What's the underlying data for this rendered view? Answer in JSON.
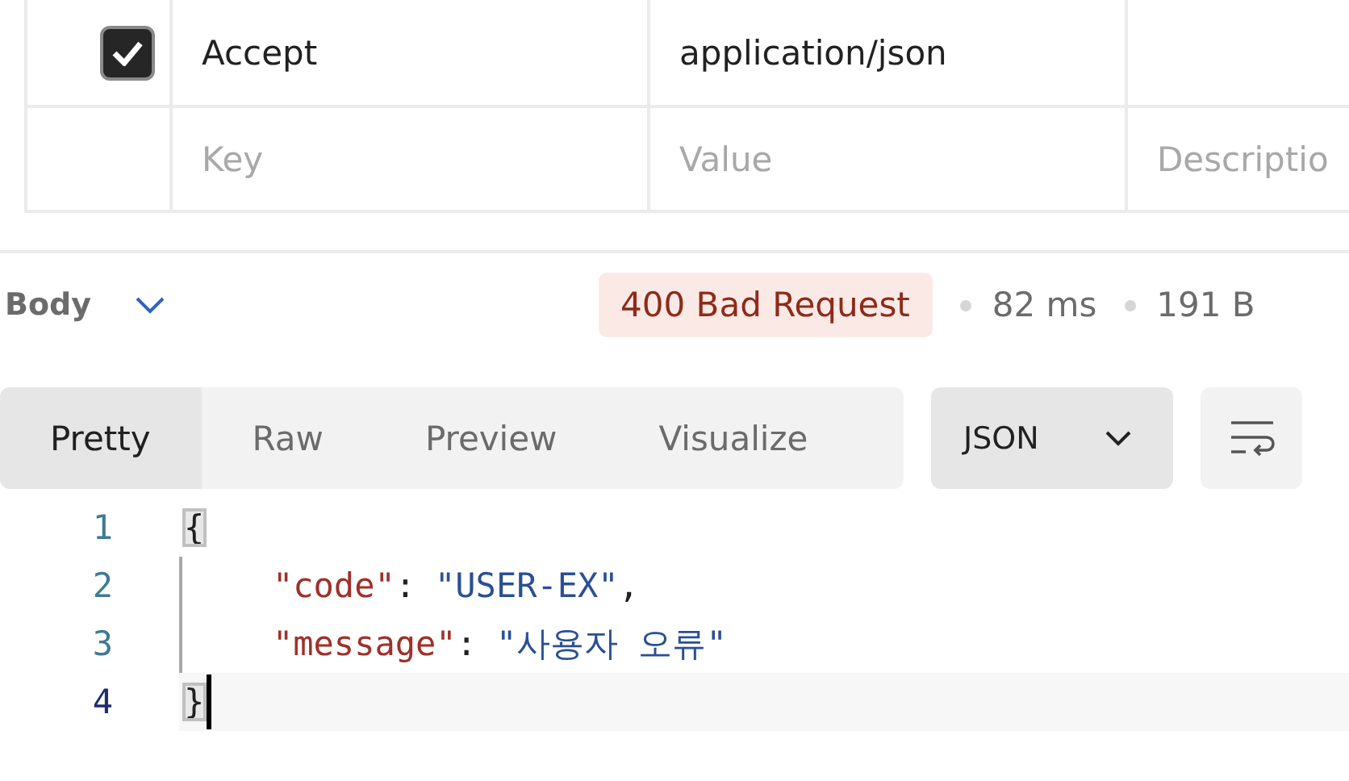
{
  "headers_table": {
    "rows": [
      {
        "checked": true,
        "key": "Accept",
        "value": "application/json"
      }
    ],
    "new_row": {
      "key_placeholder": "Key",
      "value_placeholder": "Value",
      "description_placeholder": "Descriptio"
    }
  },
  "response_bar": {
    "section": "Body",
    "status": "400 Bad Request",
    "time": "82 ms",
    "size": "191 B"
  },
  "view_tabs": [
    {
      "label": "Pretty",
      "selected": true
    },
    {
      "label": "Raw",
      "selected": false
    },
    {
      "label": "Preview",
      "selected": false
    },
    {
      "label": "Visualize",
      "selected": false
    }
  ],
  "format_select": {
    "value": "JSON"
  },
  "code_lines": [
    {
      "number": "1",
      "kind": "brace",
      "selected": false,
      "tokens": [
        {
          "kind": "brace",
          "text": "{",
          "matched": true
        }
      ]
    },
    {
      "number": "2",
      "kind": "member",
      "selected": false,
      "tokens": [
        {
          "kind": "key",
          "text": "\"code\""
        },
        {
          "kind": "punct",
          "text": ":"
        },
        {
          "kind": "string",
          "text": "\"USER-EX\""
        },
        {
          "kind": "punct",
          "text": ","
        }
      ]
    },
    {
      "number": "3",
      "kind": "member",
      "selected": false,
      "tokens": [
        {
          "kind": "key",
          "text": "\"message\""
        },
        {
          "kind": "punct",
          "text": ":"
        },
        {
          "kind": "string",
          "text": "\"사용자 오류\""
        }
      ]
    },
    {
      "number": "4",
      "kind": "brace",
      "selected": true,
      "tokens": [
        {
          "kind": "brace",
          "text": "}",
          "matched": true
        }
      ]
    }
  ]
}
